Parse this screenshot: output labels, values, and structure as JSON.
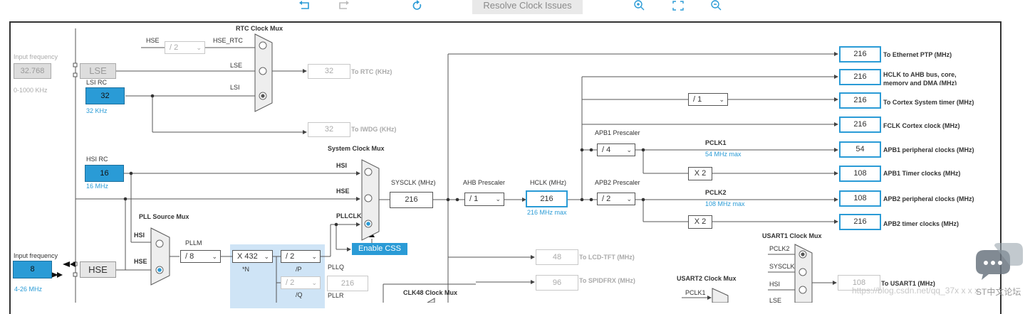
{
  "toolbar": {
    "resolve_label": "Resolve Clock Issues",
    "icons": [
      "undo-icon",
      "redo-icon",
      "refresh-icon",
      "zoom-in-icon",
      "fit-screen-icon",
      "zoom-out-icon"
    ]
  },
  "lse": {
    "input_label": "Input frequency",
    "input_value": "32.768",
    "range": "0-1000 KHz",
    "name": "LSE"
  },
  "lsi": {
    "title": "LSI RC",
    "value": "32",
    "freq": "32 KHz"
  },
  "hsi": {
    "title": "HSI RC",
    "value": "16",
    "freq": "16 MHz"
  },
  "hse": {
    "input_label": "Input frequency",
    "value": "8",
    "range": "4-26 MHz",
    "name": "HSE"
  },
  "rtc": {
    "mux_title": "RTC Clock Mux",
    "hse_label": "HSE",
    "div_value": "/ 2",
    "hse_rtc": "HSE_RTC",
    "in_lse": "LSE",
    "in_lsi": "LSI",
    "out_value": "32",
    "out_label": "To RTC (KHz)",
    "iwdg_value": "32",
    "iwdg_label": "To IWDG (KHz)"
  },
  "sysmux": {
    "title": "System Clock Mux",
    "hsi": "HSI",
    "hse": "HSE",
    "pllclk": "PLLCLK",
    "enable_css": "Enable CSS"
  },
  "pllsrc": {
    "title": "PLL Source Mux",
    "hsi": "HSI",
    "hse": "HSE"
  },
  "pll": {
    "pllm_label": "PLLM",
    "pllm_value": "/ 8",
    "n_value": "X 432",
    "n_label": "*N",
    "p_value": "/ 2",
    "p_label": "/P",
    "q_value": "/ 2",
    "q_label": "/Q",
    "pllq": "PLLQ",
    "pllq_value": "216",
    "pllr": "PLLR"
  },
  "sysclk": {
    "label": "SYSCLK (MHz)",
    "value": "216"
  },
  "ahb": {
    "label": "AHB Prescaler",
    "value": "/ 1"
  },
  "hclk": {
    "label": "HCLK (MHz)",
    "value": "216",
    "max": "216 MHz max"
  },
  "apb1": {
    "label": "APB1 Prescaler",
    "value": "/ 4",
    "pclk": "PCLK1",
    "max": "54 MHz max"
  },
  "apb2": {
    "label": "APB2 Prescaler",
    "value": "/ 2",
    "pclk": "PCLK2",
    "max": "108 MHz max"
  },
  "cortex_div": "/ 1",
  "x2a": "X 2",
  "x2b": "X 2",
  "outputs": [
    {
      "value": "216",
      "label": "To Ethernet PTP (MHz)"
    },
    {
      "value": "216",
      "label": "HCLK to AHB bus, core,",
      "label2": "memory and DMA (MHz)"
    },
    {
      "value": "216",
      "label": "To Cortex System timer (MHz)"
    },
    {
      "value": "216",
      "label": "FCLK Cortex clock (MHz)"
    },
    {
      "value": "54",
      "label": "APB1 peripheral clocks (MHz)"
    },
    {
      "value": "108",
      "label": "APB1 Timer clocks (MHz)"
    },
    {
      "value": "108",
      "label": "APB2 peripheral clocks (MHz)"
    },
    {
      "value": "216",
      "label": "APB2 timer clocks (MHz)"
    }
  ],
  "lower": {
    "lcd_value": "48",
    "lcd_label": "To LCD-TFT (MHz)",
    "spdif_value": "96",
    "spdif_label": "To SPIDFRX (MHz)",
    "clk48_title": "CLK48 Clock Mux",
    "usart2_title": "USART2 Clock Mux",
    "usart2_in": "PCLK1",
    "usart1_title": "USART1 Clock Mux",
    "usart1_in1": "PCLK2",
    "usart1_in2": "SYSCLK",
    "usart1_in3": "HSI",
    "usart1_in4": "LSE",
    "usart1_value": "108",
    "usart1_label": "To USART1 (MHz)"
  },
  "watermark": {
    "url": "https://blog.csdn.net/qq_37x x x x",
    "brand": "ST中文论坛"
  }
}
